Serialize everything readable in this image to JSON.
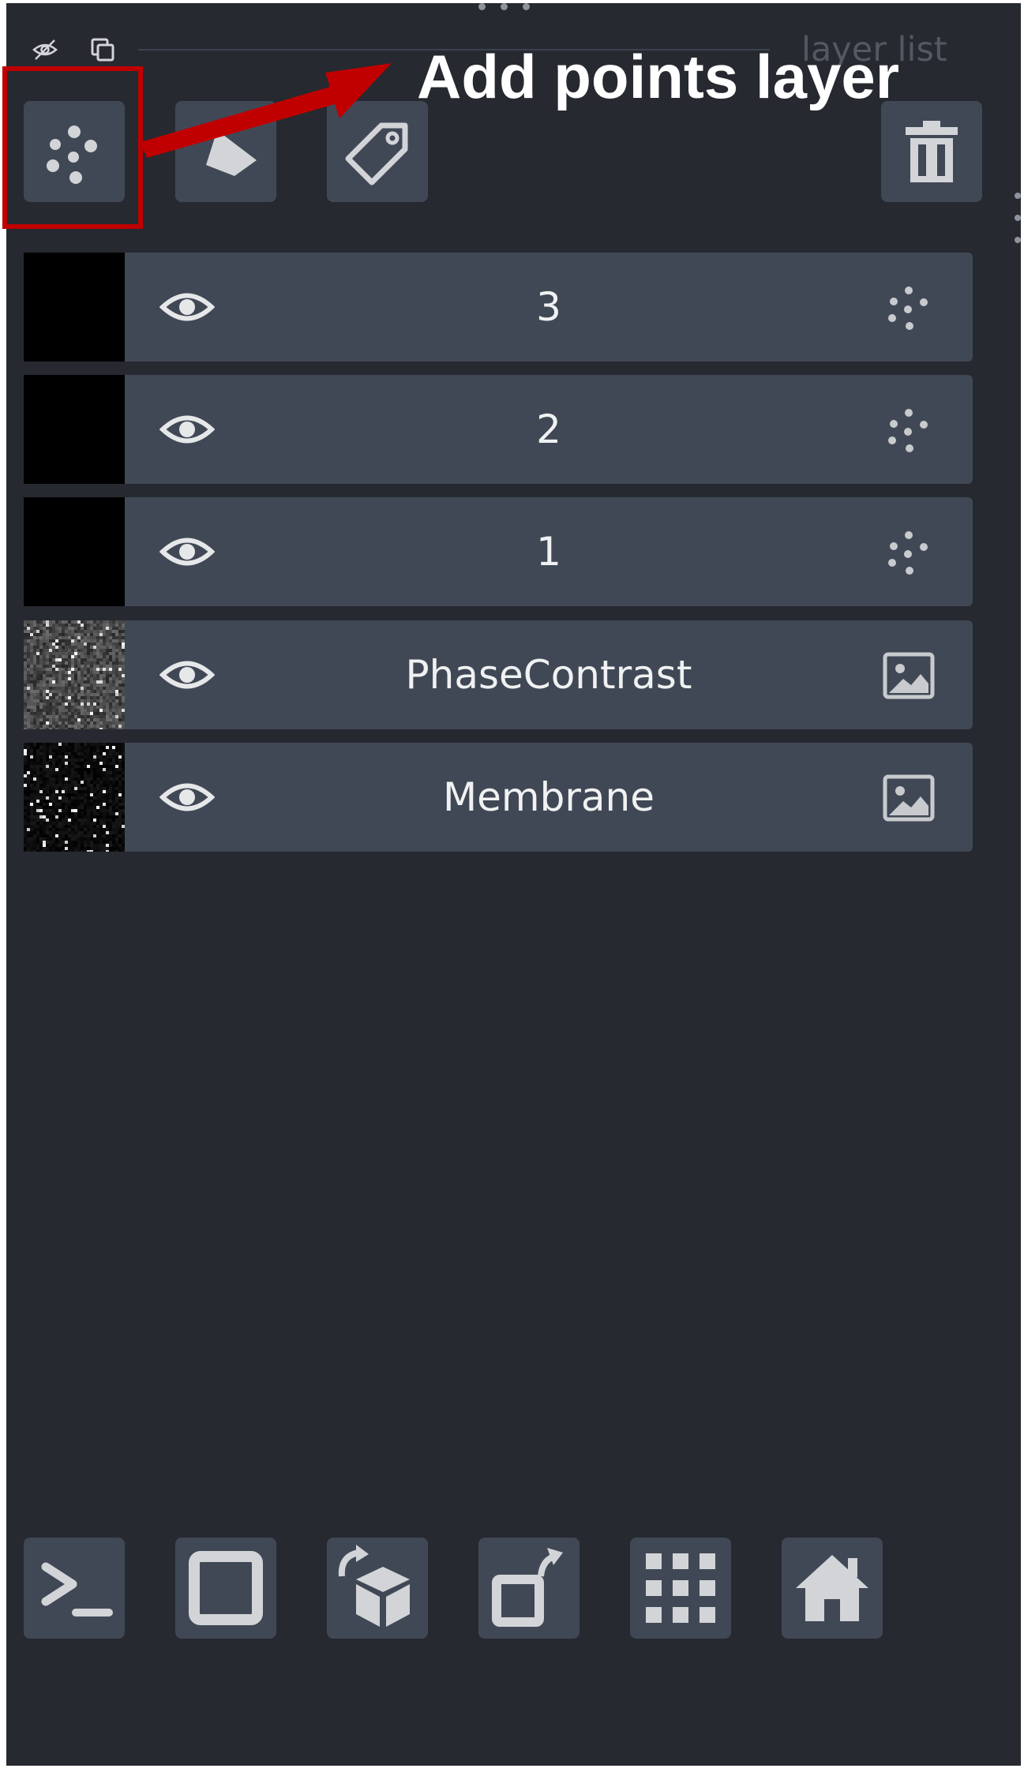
{
  "panel": {
    "title": "layer list",
    "background": "#262930",
    "button_color": "#414855"
  },
  "toolbar": {
    "top": [
      {
        "name": "add-points-layer",
        "icon": "points-icon"
      },
      {
        "name": "add-shapes-layer",
        "icon": "shapes-icon"
      },
      {
        "name": "add-labels-layer",
        "icon": "tag-icon"
      },
      {
        "name": "delete-layer",
        "icon": "trash-icon"
      }
    ],
    "small_toggles": [
      {
        "name": "toggle-visibility",
        "icon": "eye-slash-icon"
      },
      {
        "name": "duplicate",
        "icon": "copy-icon"
      }
    ]
  },
  "annotation": {
    "label": "Add points layer",
    "color": "#c00000"
  },
  "layers": [
    {
      "name": "3",
      "type": "points",
      "thumb": "black"
    },
    {
      "name": "2",
      "type": "points",
      "thumb": "black"
    },
    {
      "name": "1",
      "type": "points",
      "thumb": "black"
    },
    {
      "name": "PhaseContrast",
      "type": "image",
      "thumb": "gray-noise"
    },
    {
      "name": "Membrane",
      "type": "image",
      "thumb": "dark-noise"
    }
  ],
  "bottom_buttons": [
    {
      "name": "console",
      "icon": "terminal-icon"
    },
    {
      "name": "toggle-ndisplay",
      "icon": "square-icon"
    },
    {
      "name": "roll-dims",
      "icon": "cube-rotate-icon"
    },
    {
      "name": "transpose-dims",
      "icon": "square-rotate-icon"
    },
    {
      "name": "grid-mode",
      "icon": "grid-icon"
    },
    {
      "name": "reset-view",
      "icon": "home-icon"
    }
  ]
}
